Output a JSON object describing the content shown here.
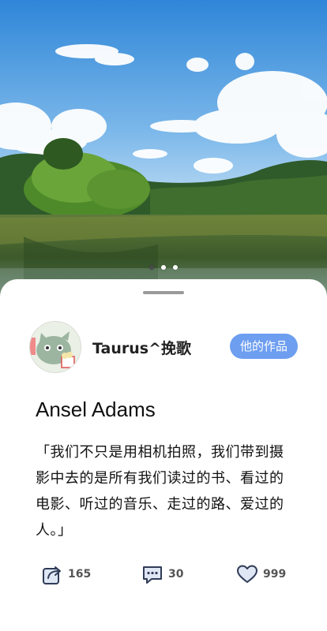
{
  "hero": {
    "image": "lake-forest-landscape",
    "carousel": {
      "count": 3,
      "active_index": 0
    }
  },
  "author": {
    "name": "Taurus^挽歌",
    "avatar_icon": "cat-with-popcorn-avatar",
    "works_button_label": "他的作品"
  },
  "post": {
    "title": "Ansel Adams",
    "quote": "「我们不只是用相机拍照，我们带到摄影中去的是所有我们读过的书、看过的电影、听过的音乐、走过的路、爱过的人。」"
  },
  "actions": {
    "share": {
      "icon": "share-icon",
      "count": "165"
    },
    "comment": {
      "icon": "comment-icon",
      "count": "30"
    },
    "like": {
      "icon": "heart-icon",
      "count": "999"
    }
  },
  "colors": {
    "accent": "#6d9ef0",
    "icon": "#2f3b57",
    "text": "#111111"
  }
}
